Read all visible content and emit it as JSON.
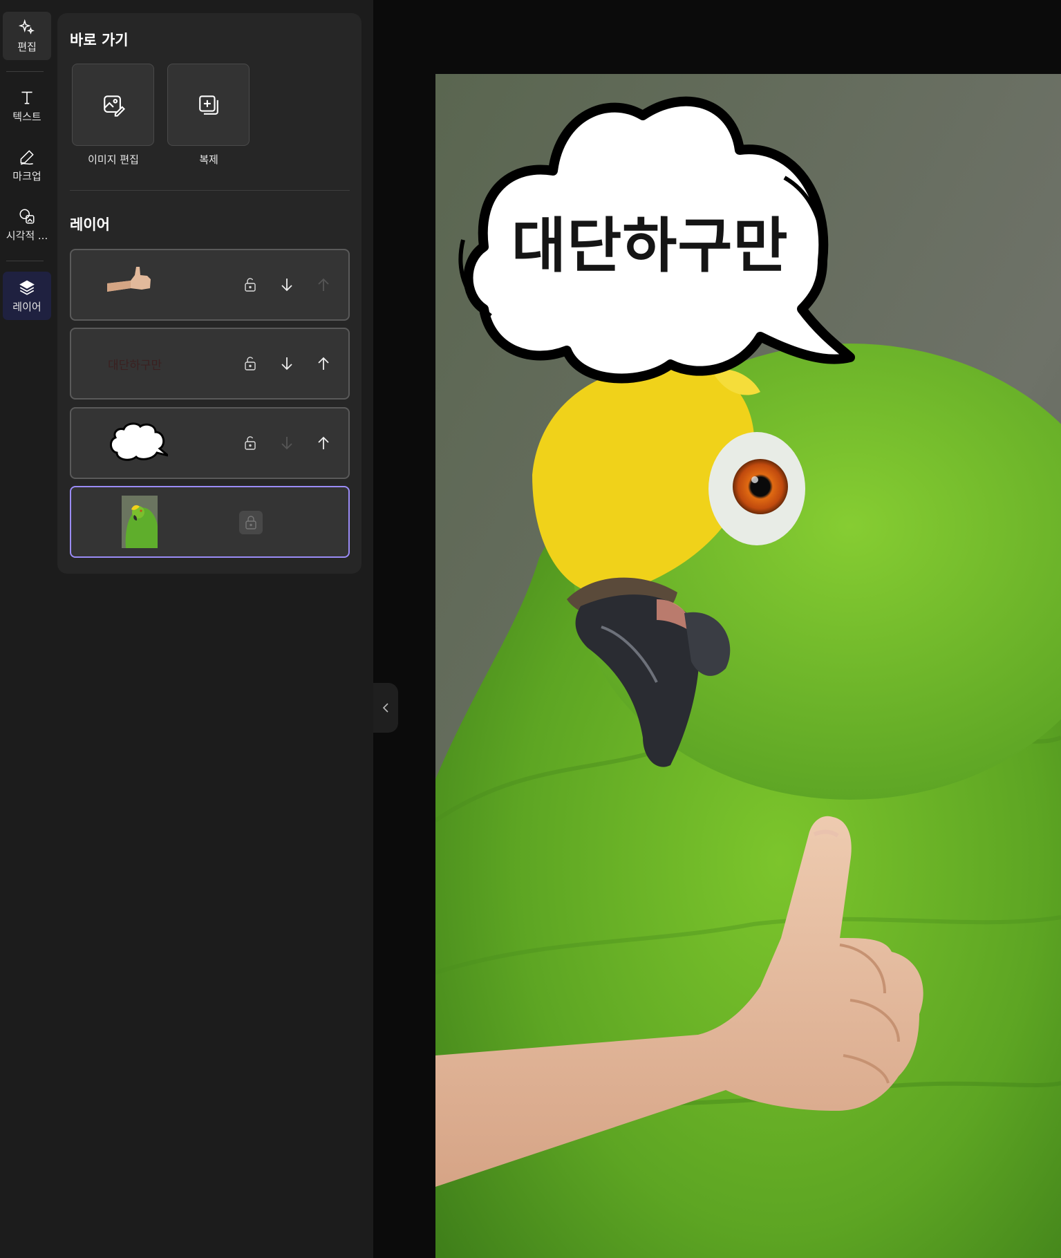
{
  "rail": {
    "items": [
      {
        "label": "편집",
        "icon": "sparkle-edit-icon"
      },
      {
        "label": "텍스트",
        "icon": "text-icon"
      },
      {
        "label": "마크업",
        "icon": "pen-markup-icon"
      },
      {
        "label": "시각적 ...",
        "icon": "visual-shapes-icon"
      },
      {
        "label": "레이어",
        "icon": "layers-icon"
      }
    ]
  },
  "panel": {
    "quick_title": "바로 가기",
    "quick_actions": [
      {
        "label": "이미지 편집",
        "icon": "image-edit-icon"
      },
      {
        "label": "복제",
        "icon": "duplicate-icon"
      }
    ],
    "layers_title": "레이어",
    "layers": [
      {
        "name": "thumbs-up-hand",
        "thumb_text": "",
        "move_up_enabled": false,
        "move_down_enabled": true
      },
      {
        "name": "text-layer",
        "thumb_text": "대단하구만",
        "move_up_enabled": true,
        "move_down_enabled": true
      },
      {
        "name": "speech-bubble",
        "thumb_text": "",
        "move_up_enabled": true,
        "move_down_enabled": false
      },
      {
        "name": "parrot-background",
        "thumb_text": "",
        "locked": true,
        "selected": true
      }
    ]
  },
  "canvas": {
    "bubble_text": "대단하구만"
  },
  "colors": {
    "accent": "#9b8cf7",
    "panel_bg": "#262626",
    "canvas_bg": "#0b0b0b"
  }
}
